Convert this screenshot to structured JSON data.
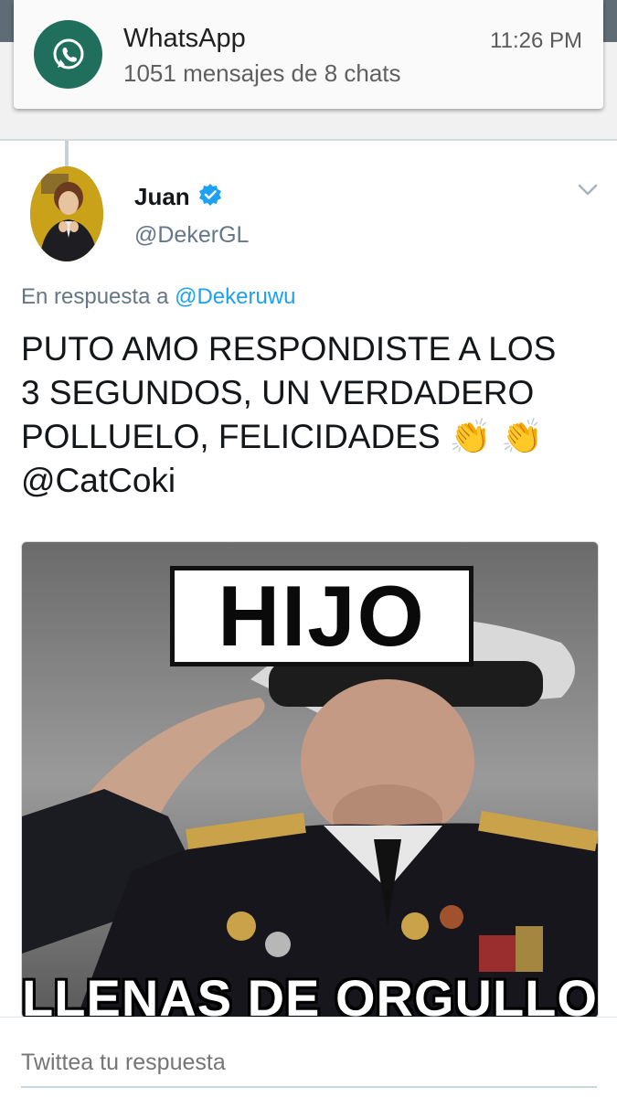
{
  "notification": {
    "app_name": "WhatsApp",
    "time": "11:26 PM",
    "message": "1051 mensajes de 8 chats",
    "icon": "whatsapp-icon",
    "icon_color": "#1f6f5c"
  },
  "tweet": {
    "author_name": "Juan",
    "verified": true,
    "handle": "@DekerGL",
    "reply_prefix": "En respuesta a",
    "reply_mention": "@Dekeruwu",
    "text": "PUTO AMO RESPONDISTE A LOS\n3 SEGUNDOS, UN VERDADERO\nPOLLUELO, FELICIDADES 👏 👏\n@CatCoki",
    "media": {
      "top_caption": "HIJO",
      "bottom_caption": "LLENAS DE ORGULLO"
    }
  },
  "reply_box": {
    "placeholder": "Twittea tu respuesta"
  },
  "colors": {
    "link": "#1da1f2",
    "secondary_text": "#657786",
    "verified_badge": "#1da1f2"
  }
}
